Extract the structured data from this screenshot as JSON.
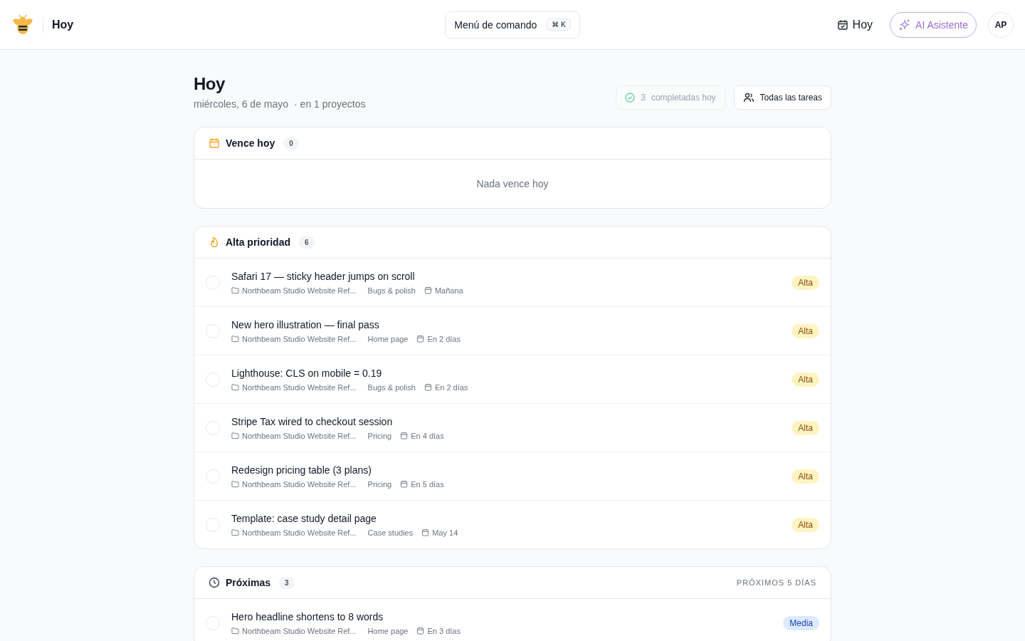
{
  "header": {
    "title": "Hoy",
    "command": {
      "label": "Menú de comando",
      "shortcut": "⌘ K"
    },
    "today_button": "Hoy",
    "ai_button": "AI Asistente",
    "avatar": "AP"
  },
  "page": {
    "title": "Hoy",
    "date": "miércoles, 6 de mayo",
    "projects": "· en 1 proyectos",
    "completed": {
      "count": "3",
      "label": "completadas hoy"
    },
    "filter_button": "Todas las tareas"
  },
  "sections": [
    {
      "kind": "due",
      "title": "Vence hoy",
      "count": "0",
      "empty": "Nada vence hoy"
    },
    {
      "kind": "priority",
      "title": "Alta prioridad",
      "count": "6",
      "tasks": [
        {
          "title": "Safari 17 — sticky header jumps on scroll",
          "project": "Northbeam Studio Website Ref...",
          "list": "Bugs & polish",
          "due": "Mañana",
          "checked": false,
          "priority": "Alta",
          "kind": "high"
        },
        {
          "title": "New hero illustration — final pass",
          "project": "Northbeam Studio Website Ref...",
          "list": "Home page",
          "due": "En 2 días",
          "checked": false,
          "priority": "Alta",
          "kind": "high"
        },
        {
          "title": "Lighthouse: CLS on mobile = 0.19",
          "project": "Northbeam Studio Website Ref...",
          "list": "Bugs & polish",
          "due": "En 2 días",
          "checked": false,
          "priority": "Alta",
          "kind": "high"
        },
        {
          "title": "Stripe Tax wired to checkout session",
          "project": "Northbeam Studio Website Ref...",
          "list": "Pricing",
          "due": "En 4 días",
          "checked": false,
          "priority": "Alta",
          "kind": "high"
        },
        {
          "title": "Redesign pricing table (3 plans)",
          "project": "Northbeam Studio Website Ref...",
          "list": "Pricing",
          "due": "En 5 días",
          "checked": false,
          "priority": "Alta",
          "kind": "high"
        },
        {
          "title": "Template: case study detail page",
          "project": "Northbeam Studio Website Ref...",
          "list": "Case studies",
          "due": "May 14",
          "checked": false,
          "priority": "Alta",
          "kind": "high"
        }
      ]
    },
    {
      "kind": "upcoming",
      "title": "Próximas",
      "count": "3",
      "note": "PRÓXIMOS 5 DÍAS",
      "tasks": [
        {
          "title": "Hero headline shortens to 8 words",
          "project": "Northbeam Studio Website Ref...",
          "list": "Home page",
          "due": "En 3 días",
          "checked": false,
          "priority": "Media",
          "kind": "medium"
        }
      ]
    }
  ]
}
